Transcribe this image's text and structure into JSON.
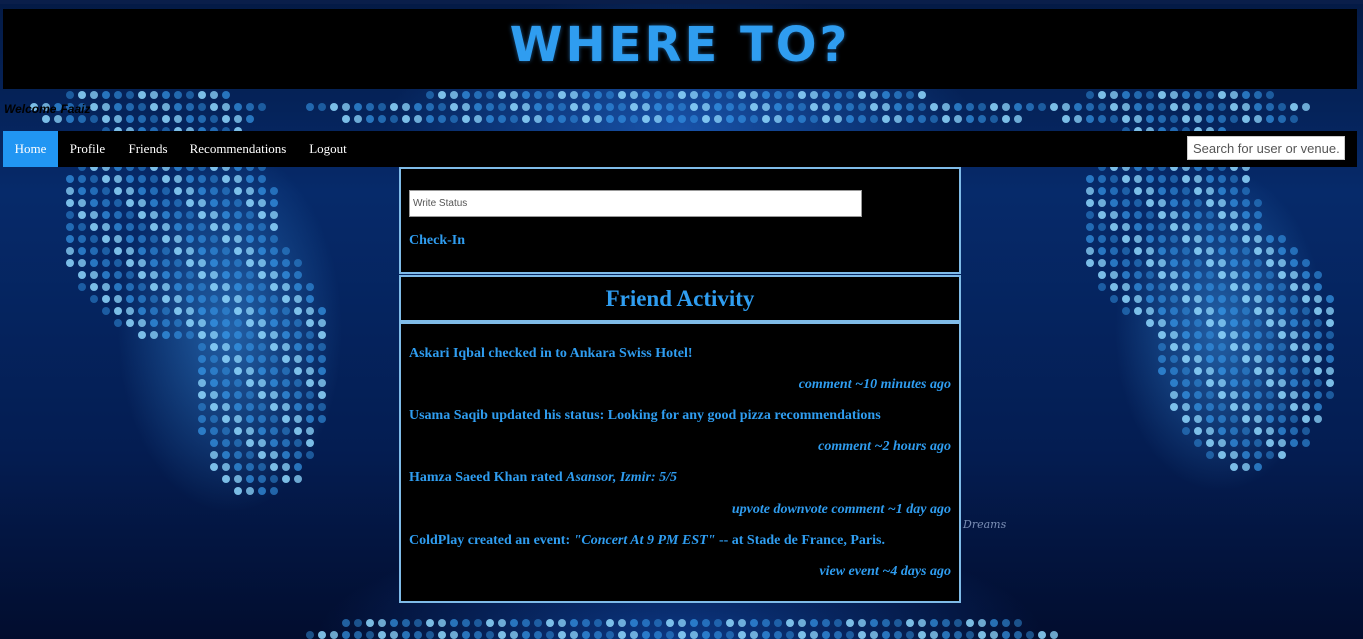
{
  "header": {
    "title": "WHERE TO?"
  },
  "welcome": {
    "prefix": "Welcome",
    "user": "Faaiz"
  },
  "nav": {
    "items": [
      {
        "label": "Home",
        "active": true
      },
      {
        "label": "Profile"
      },
      {
        "label": "Friends"
      },
      {
        "label": "Recommendations"
      },
      {
        "label": "Logout"
      }
    ],
    "search_placeholder": "Search for user or venue.."
  },
  "status": {
    "placeholder": "Write Status",
    "checkin_label": "Check-In"
  },
  "activity": {
    "title": "Friend Activity",
    "items": [
      {
        "user": "Askari Iqbal",
        "text": "checked in to Ankara Swiss Hotel!",
        "comment": "comment",
        "time": "~10 minutes ago"
      },
      {
        "user": "Usama Saqib",
        "text": "updated his status: Looking for any good pizza recommendations",
        "comment": "comment",
        "time": "~2 hours ago"
      },
      {
        "user": "Hamza Saeed Khan",
        "text": "rated",
        "venue": "Asansor, Izmir: 5/5",
        "upvote": "upvote",
        "downvote": "downvote",
        "comment": "comment",
        "time": "~1 day ago"
      },
      {
        "user": "ColdPlay",
        "text": "created an event:",
        "event": "\"Concert At 9 PM EST\"",
        "location": "-- at Stade de France, Paris.",
        "view_event": "view event",
        "time": "~4 days ago"
      }
    ]
  },
  "background": {
    "signature": "Dreams"
  },
  "colors": {
    "accent": "#2f9df0",
    "nav_active": "#2196f3",
    "panel_border": "#7fbbe8",
    "panel_bg": "#000000"
  }
}
